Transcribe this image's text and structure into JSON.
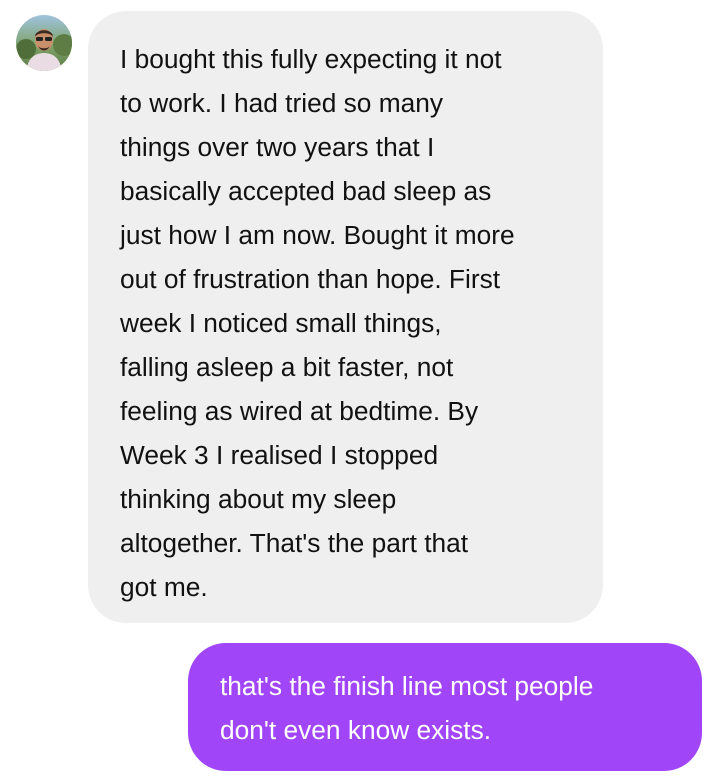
{
  "conversation": {
    "sender": {
      "avatar_icon": "user-avatar-photo"
    },
    "incoming_message": {
      "lines": [
        "I bought this fully expecting it not",
        "to work. I had tried so many",
        "things over two years that I",
        "basically accepted bad sleep as",
        "just how I am now. Bought it more",
        "out of frustration than hope. First",
        "week I noticed small things,",
        "falling asleep a bit faster, not",
        "feeling as wired at bedtime. By",
        "Week 3 I realised I stopped",
        "thinking about my sleep",
        "altogether. That's the part that",
        "got me."
      ],
      "background_color": "#efefef",
      "text_color": "#111111"
    },
    "outgoing_message": {
      "lines": [
        "that's the finish line most people",
        "don't even know exists."
      ],
      "background_color": "#a046f8",
      "text_color": "#ffffff"
    }
  }
}
